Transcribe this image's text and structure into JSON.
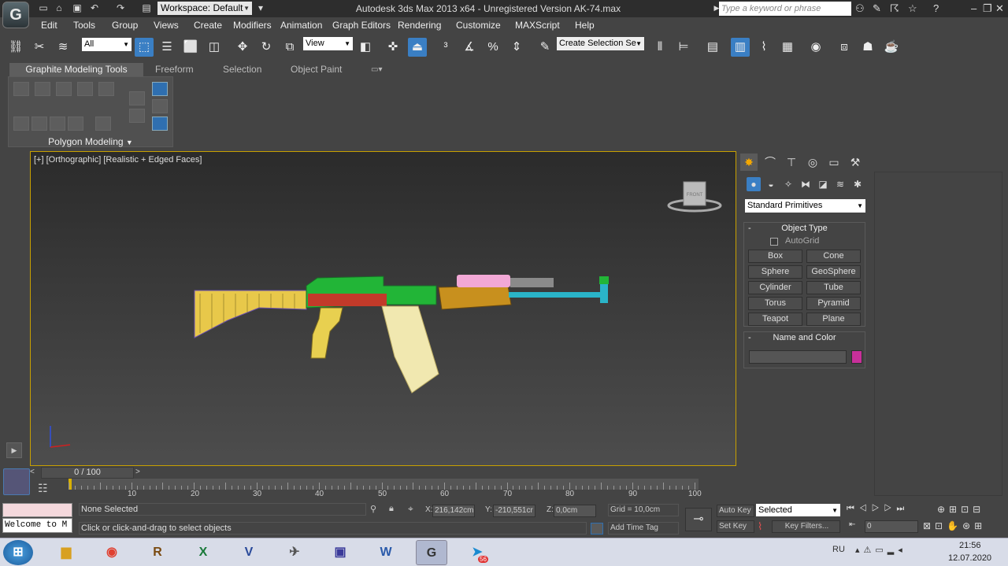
{
  "title": {
    "workspace": "Workspace: Default",
    "window_title": "Autodesk 3ds Max  2013 x64   - Unregistered Version    AK-74.max",
    "search_placeholder": "Type a keyword or phrase"
  },
  "menu": [
    "Edit",
    "Tools",
    "Group",
    "Views",
    "Create",
    "Modifiers",
    "Animation",
    "Graph Editors",
    "Rendering",
    "Customize",
    "MAXScript",
    "Help"
  ],
  "toolbar": {
    "filter": "All",
    "ref_coord": "View",
    "selection_set": "Create Selection Se"
  },
  "ribbon": {
    "tabs": [
      "Graphite Modeling Tools",
      "Freeform",
      "Selection",
      "Object Paint"
    ],
    "active_tab": "Graphite Modeling Tools",
    "panel_label": "Polygon Modeling"
  },
  "viewport": {
    "label": "[+] [Orthographic] [Realistic + Edged Faces]",
    "viewcube_label": "FRONT"
  },
  "command_panel": {
    "category": "Standard Primitives",
    "object_type_title": "Object Type",
    "autogrid": "AutoGrid",
    "buttons": [
      "Box",
      "Cone",
      "Sphere",
      "GeoSphere",
      "Cylinder",
      "Tube",
      "Torus",
      "Pyramid",
      "Teapot",
      "Plane"
    ],
    "name_color_title": "Name and Color",
    "object_color": "#c8309a",
    "rollout_toggle": "-"
  },
  "timeline": {
    "frame": "0 / 100",
    "ticks": [
      "10",
      "20",
      "30",
      "40",
      "50",
      "60",
      "70",
      "80",
      "90",
      "100"
    ]
  },
  "status": {
    "selection": "None Selected",
    "prompt": "Click or click-and-drag to select objects",
    "listener": "Welcome to M",
    "x": "216,142cm",
    "y": "-210,551cr",
    "z": "0,0cm",
    "x_label": "X:",
    "y_label": "Y:",
    "z_label": "Z:",
    "grid": "Grid = 10,0cm",
    "add_time_tag": "Add Time Tag",
    "auto_key": "Auto Key",
    "set_key": "Set Key",
    "key_mode": "Selected",
    "key_filters": "Key Filters...",
    "current_frame": "0"
  },
  "taskbar": {
    "lang": "RU",
    "time": "21:56",
    "date": "12.07.2020",
    "telegram_badge": "56"
  },
  "colors": {
    "accent": "#3a7fc4",
    "viewport_border": "#c8a000"
  }
}
